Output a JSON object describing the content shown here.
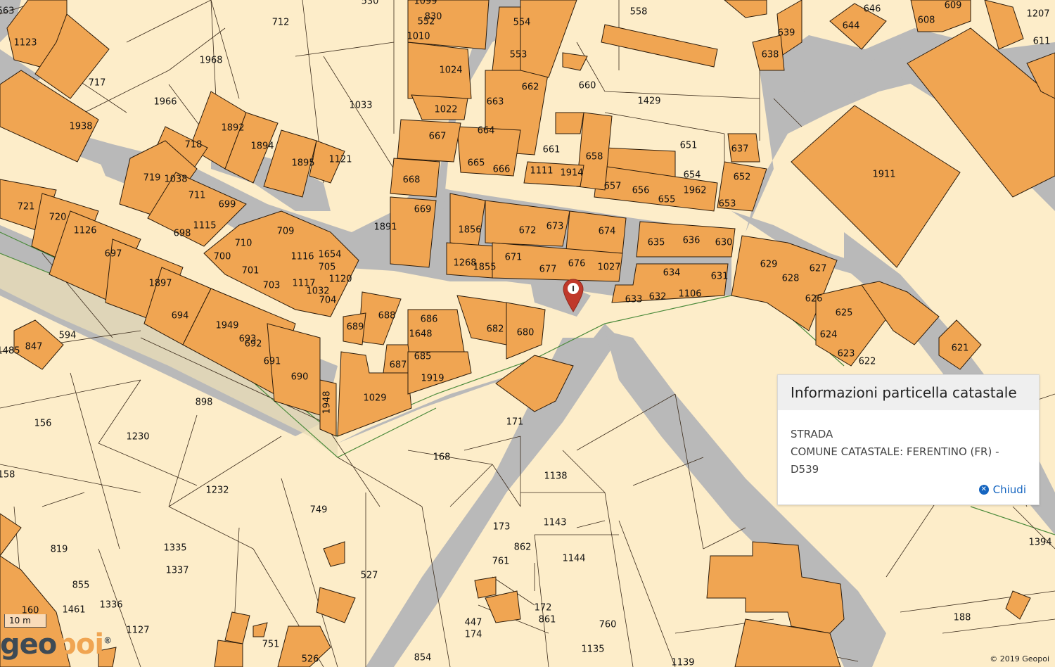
{
  "map": {
    "parcels": [
      "563",
      "1123",
      "717",
      "712",
      "1968",
      "1966",
      "1938",
      "1892",
      "1894",
      "718",
      "1895",
      "1121",
      "719",
      "1038",
      "711",
      "699",
      "1115",
      "698",
      "721",
      "720",
      "1126",
      "697",
      "709",
      "710",
      "700",
      "701",
      "703",
      "1116",
      "1654",
      "705",
      "1117",
      "1032",
      "1120",
      "704",
      "1897",
      "694",
      "1949",
      "693",
      "692",
      "691",
      "690",
      "1948",
      "1029",
      "847",
      "594",
      "1485",
      "898",
      "156",
      "1230",
      "1232",
      "749",
      "1335",
      "1337",
      "819",
      "855",
      "1461",
      "1336",
      "160",
      "1127",
      "751",
      "526",
      "854",
      "158",
      "168",
      "171",
      "1138",
      "1143",
      "173",
      "1144",
      "862",
      "761",
      "172",
      "861",
      "447",
      "174",
      "760",
      "1135",
      "1139",
      "188",
      "1394",
      "527",
      "1033",
      "1891",
      "688",
      "689",
      "686",
      "1648",
      "687",
      "685",
      "1919",
      "682",
      "680",
      "1856",
      "672",
      "673",
      "674",
      "1268",
      "1855",
      "671",
      "677",
      "676",
      "1027",
      "635",
      "636",
      "630",
      "634",
      "633",
      "632",
      "1106",
      "631",
      "629",
      "628",
      "627",
      "626",
      "625",
      "624",
      "623",
      "622",
      "621",
      "1911",
      "651",
      "637",
      "654",
      "652",
      "1962",
      "655",
      "656",
      "657",
      "653",
      "658",
      "661",
      "1111",
      "1914",
      "660",
      "1429",
      "662",
      "663",
      "664",
      "665",
      "666",
      "667",
      "668",
      "669",
      "1022",
      "1024",
      "1010",
      "552",
      "830",
      "554",
      "553",
      "558",
      "646",
      "644",
      "639",
      "638",
      "608",
      "609",
      "1207",
      "611",
      "530",
      "1099"
    ]
  },
  "info_panel": {
    "title": "Informazioni particella catastale",
    "line1": "STRADA",
    "line2": "COMUNE CATASTALE: FERENTINO (FR) - D539",
    "close_label": "Chiudi"
  },
  "scale_bar": {
    "label": "10 m"
  },
  "logo": {
    "part1": "geo",
    "part2": "poi",
    "mark": "®"
  },
  "copyright": "© 2019 Geopoi",
  "marker_label": "I"
}
